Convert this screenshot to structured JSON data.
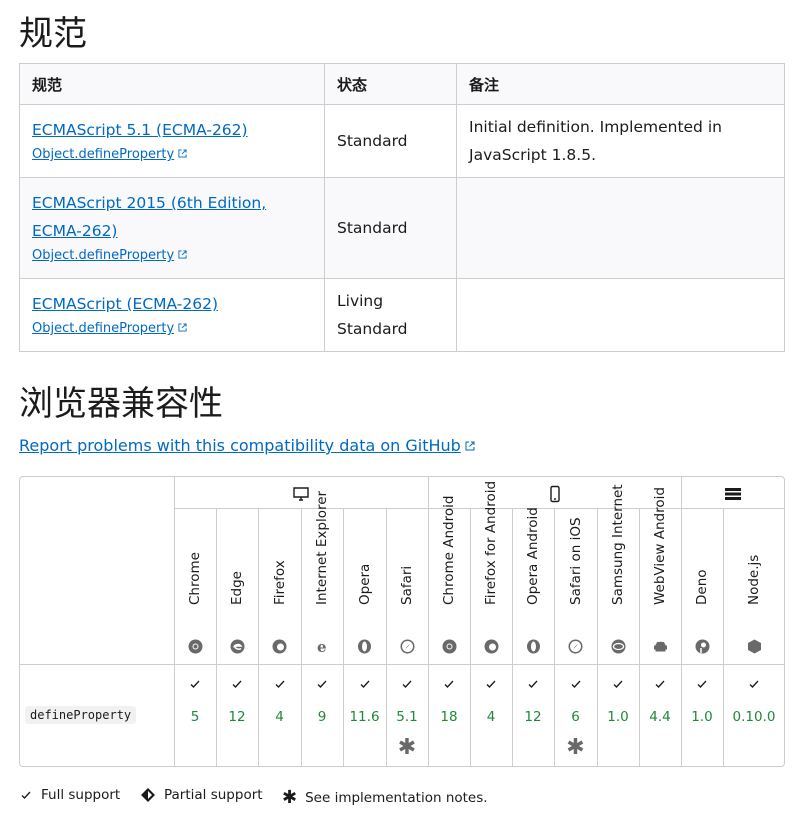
{
  "spec_section": {
    "title": "规范",
    "headers": [
      "规范",
      "状态",
      "备注"
    ],
    "rows": [
      {
        "spec_line1": "ECMAScript 5.1 (ECMA-262)",
        "spec_line2": "",
        "subref": "Object.defineProperty",
        "status_line1": "Standard",
        "status_line2": "",
        "note_line1": "Initial definition. Implemented in",
        "note_line2": "JavaScript 1.8.5."
      },
      {
        "spec_line1": "ECMAScript 2015 (6th Edition,",
        "spec_line2": "ECMA-262)",
        "subref": "Object.defineProperty",
        "status_line1": "Standard",
        "status_line2": "",
        "note_line1": "",
        "note_line2": ""
      },
      {
        "spec_line1": "ECMAScript (ECMA-262)",
        "spec_line2": "",
        "subref": "Object.defineProperty",
        "status_line1": "Living",
        "status_line2": "Standard",
        "note_line1": "",
        "note_line2": ""
      }
    ]
  },
  "compat_section": {
    "title": "浏览器兼容性",
    "report_link": "Report problems with this compatibility data on GitHub",
    "groups": [
      {
        "name": "desktop",
        "icon": "desktop-icon"
      },
      {
        "name": "mobile",
        "icon": "mobile-icon"
      },
      {
        "name": "server",
        "icon": "server-icon"
      }
    ],
    "browsers": [
      {
        "name": "Chrome",
        "icon": "chrome-icon",
        "version": "5",
        "note": false
      },
      {
        "name": "Edge",
        "icon": "edge-icon",
        "version": "12",
        "note": false
      },
      {
        "name": "Firefox",
        "icon": "firefox-icon",
        "version": "4",
        "note": false
      },
      {
        "name": "Internet Explorer",
        "icon": "ie-icon",
        "version": "9",
        "note": false
      },
      {
        "name": "Opera",
        "icon": "opera-icon",
        "version": "11.6",
        "note": false
      },
      {
        "name": "Safari",
        "icon": "safari-icon",
        "version": "5.1",
        "note": true
      },
      {
        "name": "Chrome Android",
        "icon": "chrome-icon",
        "version": "18",
        "note": false
      },
      {
        "name": "Firefox for Android",
        "icon": "firefox-icon",
        "version": "4",
        "note": false
      },
      {
        "name": "Opera Android",
        "icon": "opera-icon",
        "version": "12",
        "note": false
      },
      {
        "name": "Safari on iOS",
        "icon": "safari-icon",
        "version": "6",
        "note": true
      },
      {
        "name": "Samsung Internet",
        "icon": "samsung-icon",
        "version": "1.0",
        "note": false
      },
      {
        "name": "WebView Android",
        "icon": "android-icon",
        "version": "4.4",
        "note": false
      },
      {
        "name": "Deno",
        "icon": "deno-icon",
        "version": "1.0",
        "note": false
      },
      {
        "name": "Node.js",
        "icon": "nodejs-icon",
        "version": "0.10.0",
        "note": false
      }
    ],
    "feature": "defineProperty",
    "note_symbol": "✱",
    "colors": {
      "support": "#1e8a35",
      "link": "#0069c2",
      "border": "#cdcdcd"
    }
  },
  "legend": {
    "full": "Full support",
    "partial": "Partial support",
    "notes": "See implementation notes."
  }
}
